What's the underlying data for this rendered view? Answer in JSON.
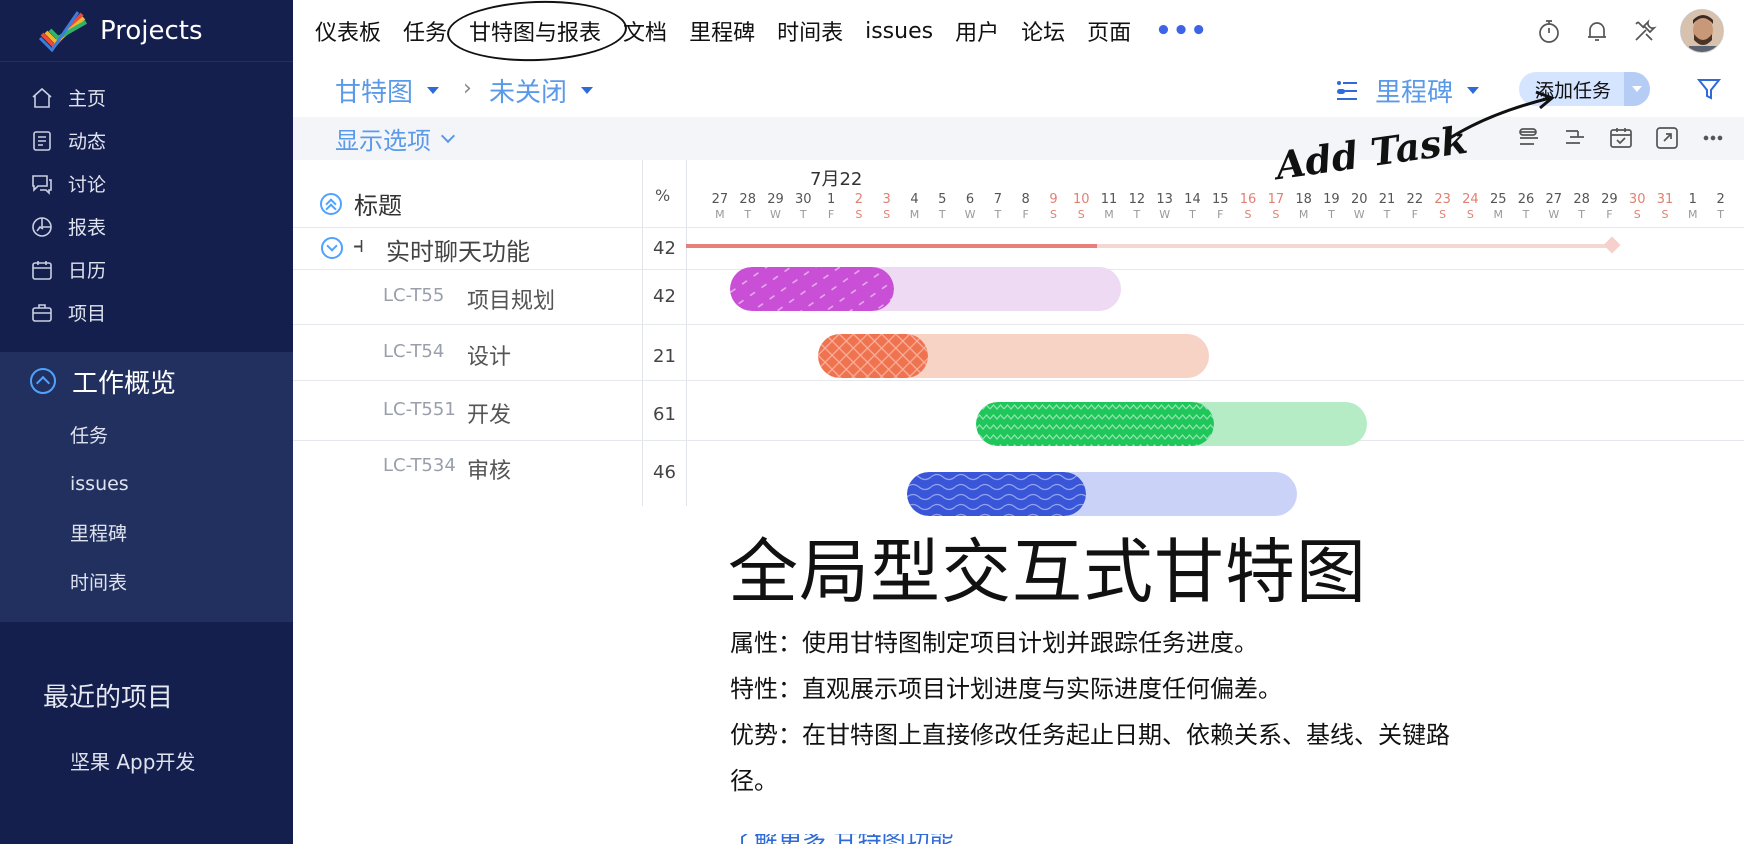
{
  "app": {
    "name": "Projects"
  },
  "sidebar": {
    "items": [
      {
        "label": "主页",
        "icon": "home-icon"
      },
      {
        "label": "动态",
        "icon": "feed-icon"
      },
      {
        "label": "讨论",
        "icon": "discussion-icon"
      },
      {
        "label": "报表",
        "icon": "report-icon"
      },
      {
        "label": "日历",
        "icon": "calendar-icon"
      },
      {
        "label": "项目",
        "icon": "briefcase-icon"
      }
    ],
    "section": {
      "title": "工作概览",
      "items": [
        "任务",
        "issues",
        "里程碑",
        "时间表"
      ]
    },
    "recent": {
      "title": "最近的项目",
      "items": [
        "坚果 App开发"
      ]
    }
  },
  "topnav": {
    "tabs": [
      "仪表板",
      "任务",
      "甘特图与报表",
      "文档",
      "里程碑",
      "时间表",
      "issues",
      "用户",
      "论坛",
      "页面"
    ],
    "more": "•••"
  },
  "toolbar": {
    "view": "甘特图",
    "filter": "未关闭",
    "separator": "›",
    "milestone": "里程碑",
    "add_task": "添加任务",
    "options": "显示选项"
  },
  "gantt": {
    "header_title": "标题",
    "header_pct": "%",
    "month": "7月22",
    "days": [
      {
        "d": "27",
        "w": "M"
      },
      {
        "d": "28",
        "w": "T"
      },
      {
        "d": "29",
        "w": "W"
      },
      {
        "d": "30",
        "w": "T"
      },
      {
        "d": "1",
        "w": "F"
      },
      {
        "d": "2",
        "w": "S",
        "we": true
      },
      {
        "d": "3",
        "w": "S",
        "we": true
      },
      {
        "d": "4",
        "w": "M"
      },
      {
        "d": "5",
        "w": "T"
      },
      {
        "d": "6",
        "w": "W"
      },
      {
        "d": "7",
        "w": "T"
      },
      {
        "d": "8",
        "w": "F"
      },
      {
        "d": "9",
        "w": "S",
        "we": true
      },
      {
        "d": "10",
        "w": "S",
        "we": true
      },
      {
        "d": "11",
        "w": "M"
      },
      {
        "d": "12",
        "w": "T"
      },
      {
        "d": "13",
        "w": "W"
      },
      {
        "d": "14",
        "w": "T"
      },
      {
        "d": "15",
        "w": "F"
      },
      {
        "d": "16",
        "w": "S",
        "we": true
      },
      {
        "d": "17",
        "w": "S",
        "we": true
      },
      {
        "d": "18",
        "w": "M"
      },
      {
        "d": "19",
        "w": "T"
      },
      {
        "d": "20",
        "w": "W"
      },
      {
        "d": "21",
        "w": "T"
      },
      {
        "d": "22",
        "w": "F"
      },
      {
        "d": "23",
        "w": "S",
        "we": true
      },
      {
        "d": "24",
        "w": "S",
        "we": true
      },
      {
        "d": "25",
        "w": "M"
      },
      {
        "d": "26",
        "w": "T"
      },
      {
        "d": "27",
        "w": "W"
      },
      {
        "d": "28",
        "w": "T"
      },
      {
        "d": "29",
        "w": "F"
      },
      {
        "d": "30",
        "w": "S",
        "we": true
      },
      {
        "d": "31",
        "w": "S",
        "we": true
      },
      {
        "d": "1",
        "w": "M"
      },
      {
        "d": "2",
        "w": "T"
      }
    ],
    "parent": {
      "name": "实时聊天功能",
      "pct": "42"
    },
    "tasks": [
      {
        "code": "LC-T55",
        "name": "项目规划",
        "pct": "42",
        "color": "#c94fd6",
        "light": "#eedaf3"
      },
      {
        "code": "LC-T54",
        "name": "设计",
        "pct": "21",
        "color": "#f07350",
        "light": "#f7d3c6"
      },
      {
        "code": "LC-T551",
        "name": "开发",
        "pct": "61",
        "color": "#1fc65a",
        "light": "#b5ecc6"
      },
      {
        "code": "LC-T534",
        "name": "审核",
        "pct": "46",
        "color": "#3a56d8",
        "light": "#cbd2f7"
      }
    ]
  },
  "feature": {
    "title": "全局型交互式甘特图",
    "lines": [
      "属性：使用甘特图制定项目计划并跟踪任务进度。",
      "特性：直观展示项目计划进度与实际进度任何偏差。",
      "优势：在甘特图上直接修改任务起止日期、依赖关系、基线、关键路径。"
    ],
    "link": "了解更多   甘特图功能"
  },
  "annotation": {
    "text": "Add Task"
  }
}
